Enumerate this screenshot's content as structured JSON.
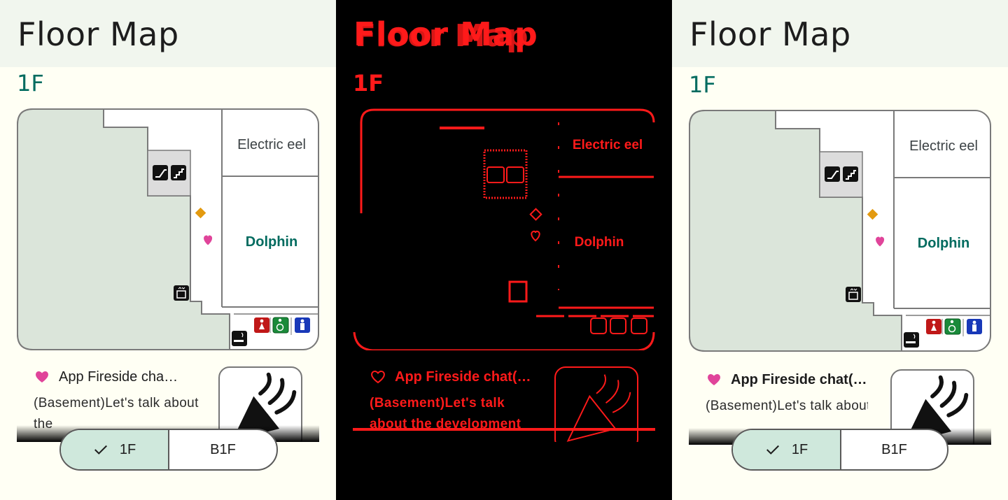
{
  "app": {
    "title": "Floor Map"
  },
  "floor": {
    "current": "1F"
  },
  "rooms": {
    "electric_eel": "Electric eel",
    "dolphin": "Dolphin"
  },
  "event": {
    "title_panel1": "App Fireside cha…",
    "title_panel2": "App Fireside chat(T…",
    "title_panel3": "App Fireside chat(T…",
    "desc_panel1": "(Basement)Let's talk about the",
    "desc_panel3": "(Basement)Let's talk about the development"
  },
  "floor_switch": {
    "options": [
      "1F",
      "B1F"
    ],
    "selected": "1F"
  },
  "colors": {
    "background": "#fffff4",
    "topbar": "#f1f6ee",
    "accent": "#006b5f",
    "selected_segment": "#cfe8dc",
    "heart": "#e0449a",
    "diamond": "#e39a10",
    "edge_red": "#ff1a1a"
  },
  "icons": [
    "escalator-icon",
    "stairs-icon",
    "elevator-icon",
    "smoking-icon",
    "female-restroom-icon",
    "accessible-restroom-icon",
    "male-restroom-icon",
    "heart-icon",
    "diamond-icon",
    "check-icon",
    "megaphone-icon"
  ]
}
